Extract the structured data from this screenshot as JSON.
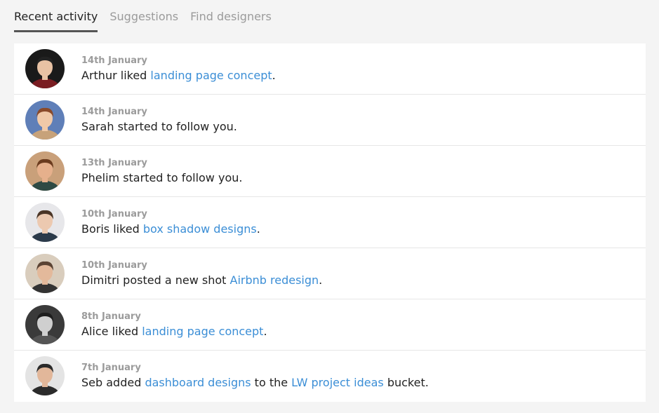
{
  "tabs": [
    {
      "label": "Recent activity",
      "active": true
    },
    {
      "label": "Suggestions",
      "active": false
    },
    {
      "label": "Find designers",
      "active": false
    }
  ],
  "colors": {
    "link": "#3b8ed6",
    "muted": "#9b9b9b",
    "text": "#222222",
    "background": "#f4f4f4"
  },
  "activities": [
    {
      "date": "14th January",
      "avatar": {
        "bg": "#1a1a1a",
        "skin": "#e8c2a4",
        "hair": "#222",
        "shirt": "#7a1d22"
      },
      "parts": [
        {
          "text": "Arthur liked "
        },
        {
          "text": "landing page concept",
          "link": true
        },
        {
          "text": "."
        }
      ]
    },
    {
      "date": "14th January",
      "avatar": {
        "bg": "#5f7fb8",
        "skin": "#f0c9a8",
        "hair": "#8a4a2a",
        "shirt": "#c7a27a"
      },
      "parts": [
        {
          "text": "Sarah started to follow you."
        }
      ]
    },
    {
      "date": "13th January",
      "avatar": {
        "bg": "#c9a07a",
        "skin": "#e6b08c",
        "hair": "#6b3b1e",
        "shirt": "#2e4a44"
      },
      "parts": [
        {
          "text": "Phelim started to follow you."
        }
      ]
    },
    {
      "date": "10th January",
      "avatar": {
        "bg": "#e7e7ea",
        "skin": "#ecc9b0",
        "hair": "#4a3526",
        "shirt": "#2b3a4a"
      },
      "parts": [
        {
          "text": "Boris liked "
        },
        {
          "text": "box shadow designs",
          "link": true
        },
        {
          "text": "."
        }
      ]
    },
    {
      "date": "10th January",
      "avatar": {
        "bg": "#d9cdbd",
        "skin": "#e3b99b",
        "hair": "#5b4333",
        "shirt": "#333333"
      },
      "parts": [
        {
          "text": "Dimitri posted a new shot "
        },
        {
          "text": "Airbnb redesign",
          "link": true
        },
        {
          "text": "."
        }
      ]
    },
    {
      "date": "8th January",
      "avatar": {
        "bg": "#3a3a3a",
        "skin": "#cfcfcf",
        "hair": "#1e1e1e",
        "shirt": "#555555"
      },
      "parts": [
        {
          "text": "Alice liked "
        },
        {
          "text": "landing page concept",
          "link": true
        },
        {
          "text": "."
        }
      ]
    },
    {
      "date": "7th January",
      "avatar": {
        "bg": "#e4e4e4",
        "skin": "#e2b79a",
        "hair": "#2a2a2a",
        "shirt": "#2b2b2b"
      },
      "parts": [
        {
          "text": "Seb added "
        },
        {
          "text": "dashboard designs",
          "link": true
        },
        {
          "text": " to the "
        },
        {
          "text": "LW project ideas",
          "link": true
        },
        {
          "text": " bucket."
        }
      ]
    }
  ]
}
